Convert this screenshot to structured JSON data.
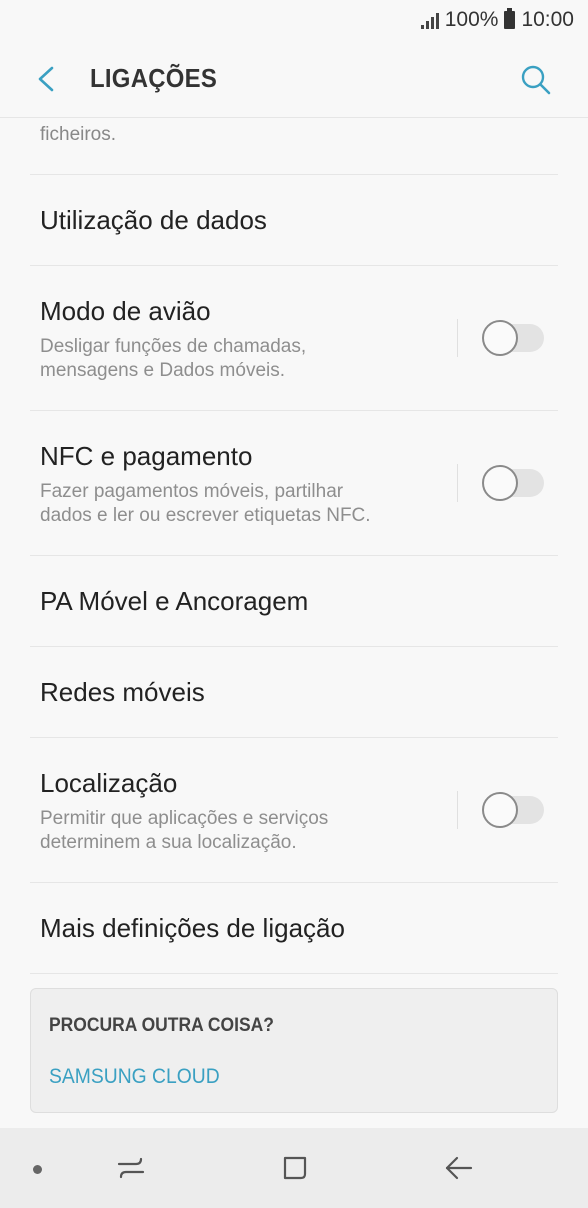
{
  "status_bar": {
    "battery": "100%",
    "time": "10:00"
  },
  "header": {
    "title": "LIGAÇÕES"
  },
  "list": {
    "partial": {
      "text": "ficheiros."
    },
    "items": [
      {
        "title": "Utilização de dados"
      },
      {
        "title": "Modo de avião",
        "subtitle_l1": "Desligar funções de chamadas,",
        "subtitle_l2": "mensagens e Dados móveis.",
        "toggle_on": false
      },
      {
        "title": "NFC e pagamento",
        "subtitle_l1": "Fazer pagamentos móveis, partilhar",
        "subtitle_l2": "dados e ler ou escrever etiquetas NFC.",
        "toggle_on": false
      },
      {
        "title": "PA Móvel e Ancoragem"
      },
      {
        "title": "Redes móveis"
      },
      {
        "title": "Localização",
        "subtitle_l1": "Permitir que aplicações e serviços",
        "subtitle_l2": "determinem a sua localização.",
        "toggle_on": false
      },
      {
        "title": "Mais definições de ligação"
      }
    ]
  },
  "suggest": {
    "title": "PROCURA OUTRA COISA?",
    "link": "SAMSUNG CLOUD"
  },
  "icons": {
    "back": "chevron-left-icon",
    "search": "search-icon",
    "signal": "signal-icon",
    "battery": "battery-icon",
    "recents": "recents-icon",
    "home": "home-icon",
    "nav_back": "back-arrow-icon"
  },
  "colors": {
    "accent": "#3aa0c2",
    "background": "#f8f8f8",
    "nav_bar": "#ececec"
  }
}
